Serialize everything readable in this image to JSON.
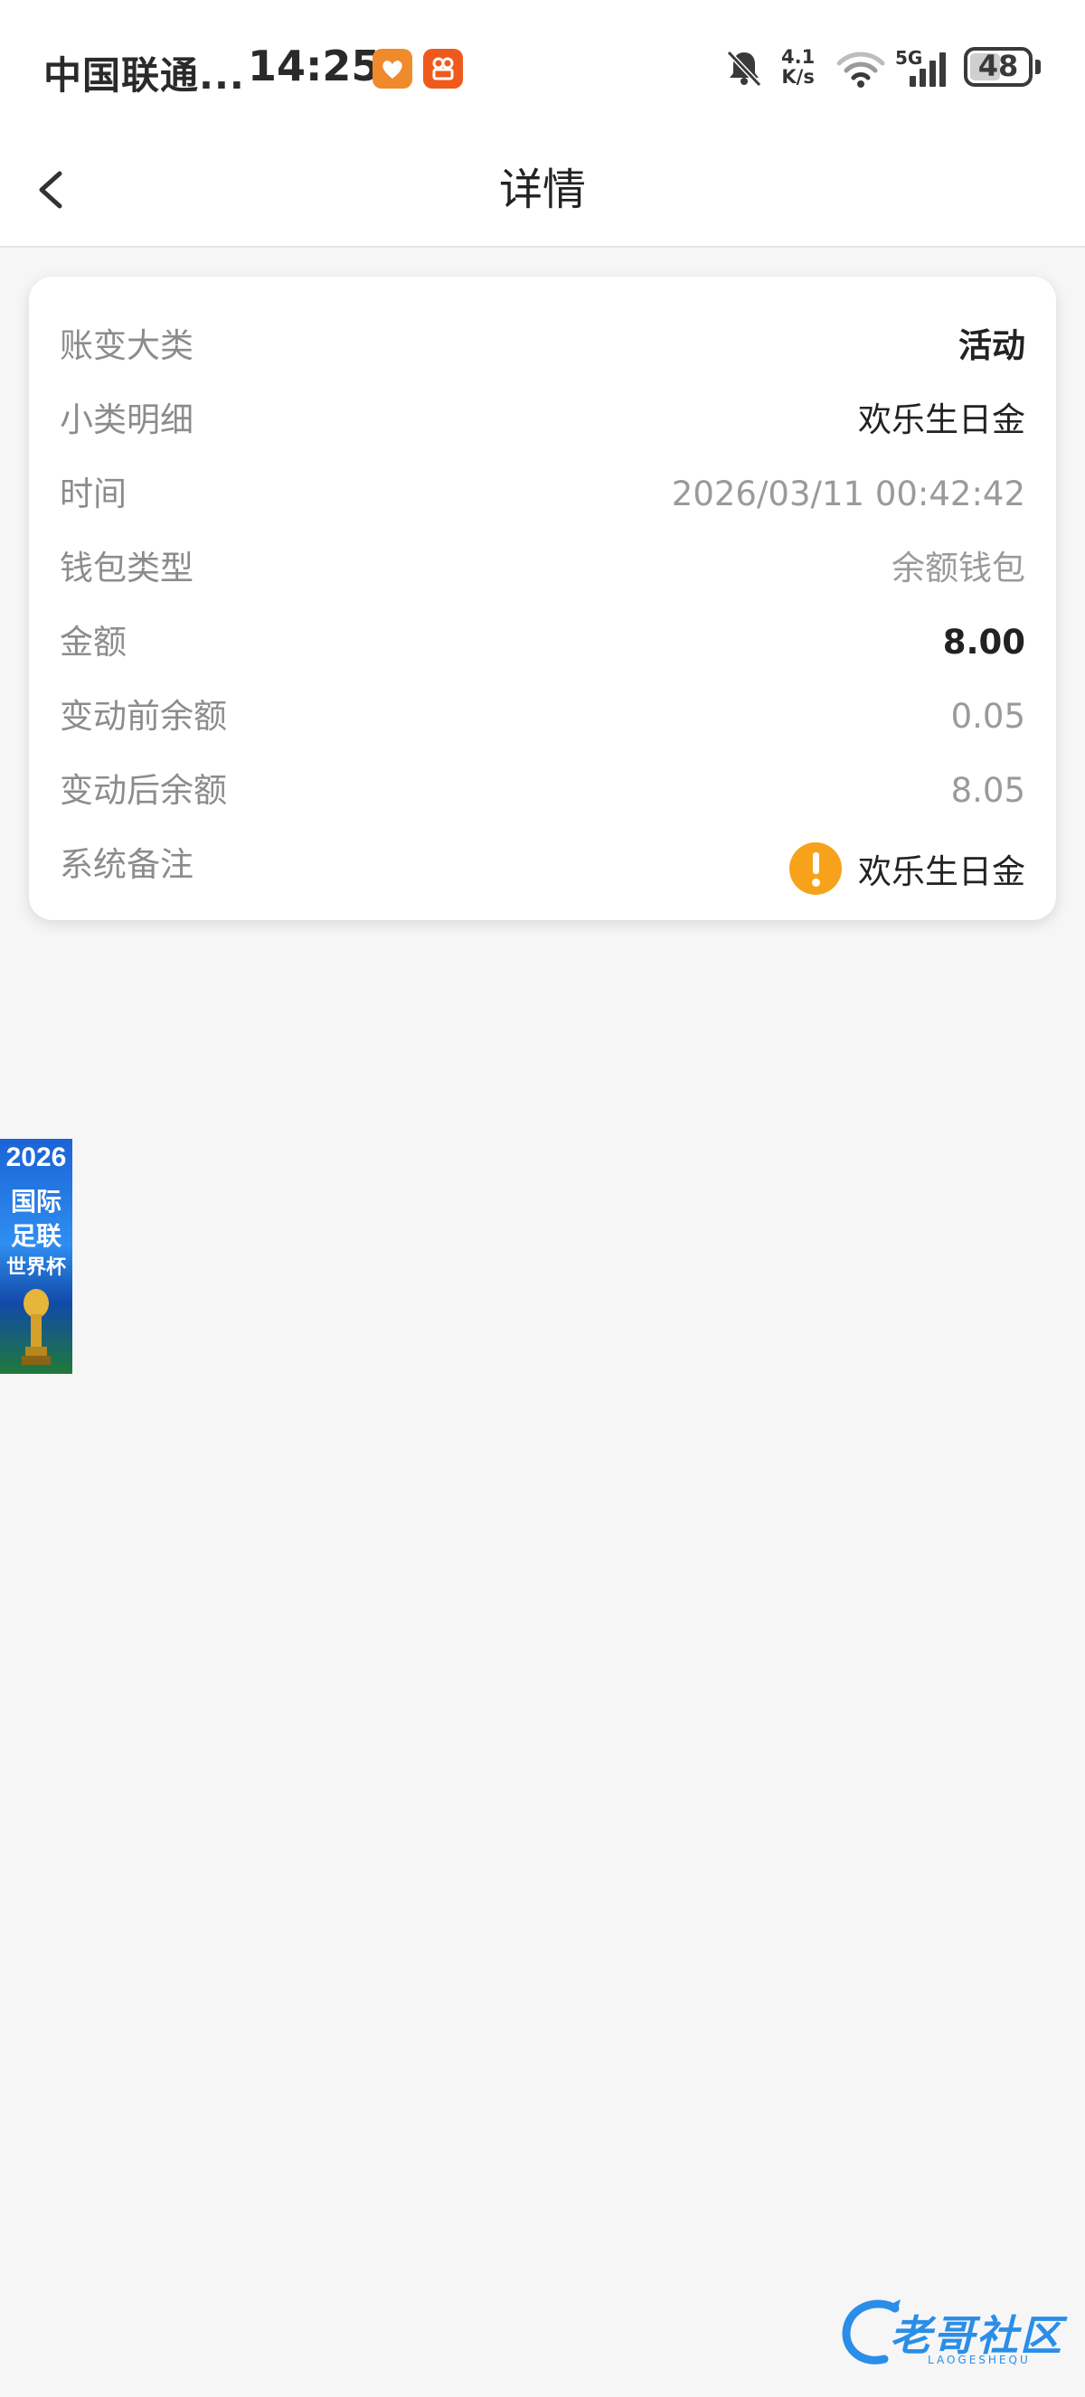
{
  "status_bar": {
    "carrier": "中国联通...",
    "time": "14:25",
    "net_speed_value": "4.1",
    "net_speed_unit": "K/s",
    "network_type": "5G",
    "battery_level": "48",
    "battery_fraction": 0.48,
    "icons": [
      "health-app-icon",
      "video-app-icon",
      "mute-bell-icon",
      "wifi-icon",
      "signal-icon",
      "battery-icon"
    ]
  },
  "nav": {
    "back_icon": "chevron-left-icon",
    "title": "详情"
  },
  "details": {
    "rows": [
      {
        "label": "账变大类",
        "value": "活动"
      },
      {
        "label": "小类明细",
        "value": "欢乐生日金"
      },
      {
        "label": "时间",
        "value": "2026/03/11 00:42:42"
      },
      {
        "label": "钱包类型",
        "value": "余额钱包"
      },
      {
        "label": "金额",
        "value": "8.00"
      },
      {
        "label": "变动前余额",
        "value": "0.05"
      },
      {
        "label": "变动后余额",
        "value": "8.05"
      },
      {
        "label": "系统备注",
        "value": "欢乐生日金",
        "icon": "warning-icon"
      }
    ]
  },
  "float_ad": {
    "year": "2026",
    "line1": "国际",
    "line2": "足联",
    "line3": "世界杯",
    "icon": "trophy-icon"
  },
  "watermark": {
    "text": "老哥社区",
    "subtext": "LAOGESHEQU"
  },
  "colors": {
    "background": "#f6f6f7",
    "card": "#ffffff",
    "label": "#8c8c8c",
    "value_dark": "#222222",
    "value_grey": "#9a9a9a",
    "warning": "#f7a21b",
    "watermark": "#2a8ee8"
  }
}
